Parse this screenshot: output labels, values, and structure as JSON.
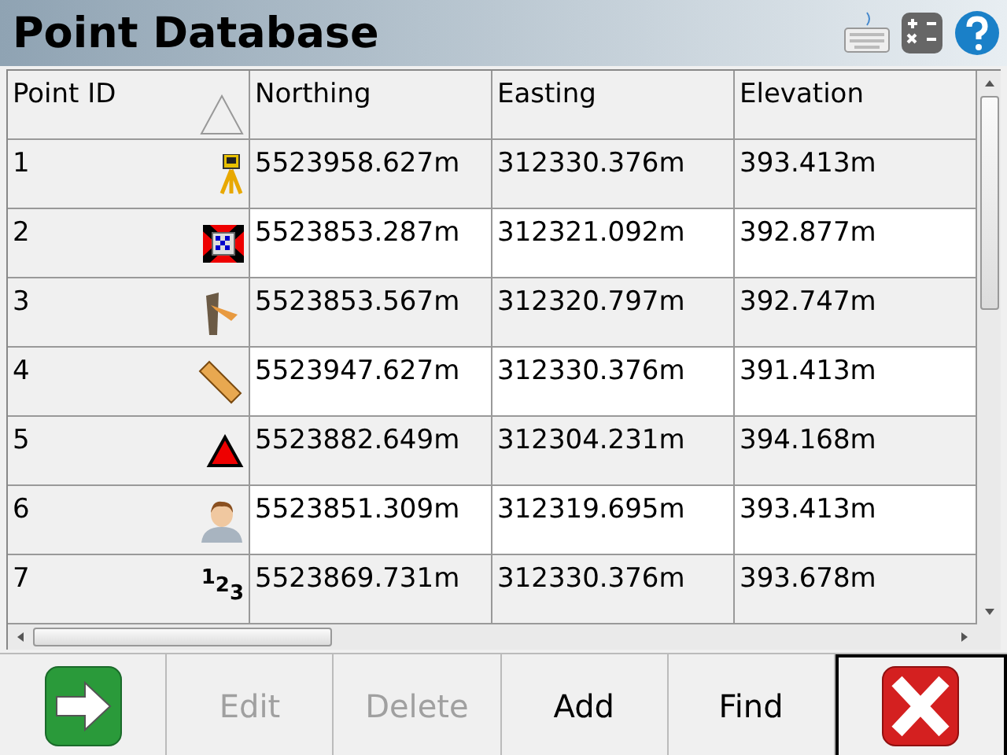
{
  "window": {
    "title": "Point Database"
  },
  "columns": [
    {
      "label": "Point ID",
      "sorted": true
    },
    {
      "label": "Northing",
      "sorted": false
    },
    {
      "label": "Easting",
      "sorted": false
    },
    {
      "label": "Elevation",
      "sorted": false
    }
  ],
  "rows": [
    {
      "id": "1",
      "kind": "instrument",
      "northing": "5523958.627m",
      "easting": "312330.376m",
      "elevation": "393.413m"
    },
    {
      "id": "2",
      "kind": "target",
      "northing": "5523853.287m",
      "easting": "312321.092m",
      "elevation": "392.877m"
    },
    {
      "id": "3",
      "kind": "stake",
      "northing": "5523853.567m",
      "easting": "312320.797m",
      "elevation": "392.747m"
    },
    {
      "id": "4",
      "kind": "ruler",
      "northing": "5523947.627m",
      "easting": "312330.376m",
      "elevation": "391.413m"
    },
    {
      "id": "5",
      "kind": "triangle",
      "northing": "5523882.649m",
      "easting": "312304.231m",
      "elevation": "394.168m"
    },
    {
      "id": "6",
      "kind": "person",
      "northing": "5523851.309m",
      "easting": "312319.695m",
      "elevation": "393.413m"
    },
    {
      "id": "7",
      "kind": "digits",
      "symbol_text": "123",
      "northing": "5523869.731m",
      "easting": "312330.376m",
      "elevation": "393.678m"
    }
  ],
  "buttons": [
    {
      "kind": "go",
      "disabled": false,
      "focused": false
    },
    {
      "kind": "text",
      "label": "Edit",
      "disabled": true,
      "focused": false
    },
    {
      "kind": "text",
      "label": "Delete",
      "disabled": true,
      "focused": false
    },
    {
      "kind": "text",
      "label": "Add",
      "disabled": false,
      "focused": false
    },
    {
      "kind": "text",
      "label": "Find",
      "disabled": false,
      "focused": false
    },
    {
      "kind": "close",
      "disabled": false,
      "focused": true
    }
  ]
}
